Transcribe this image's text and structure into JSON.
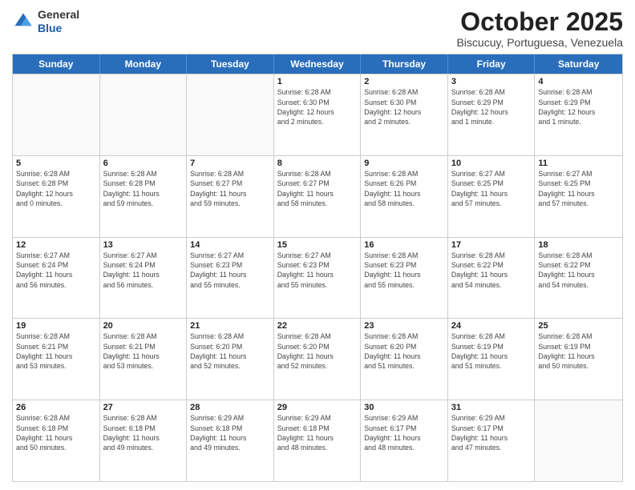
{
  "logo": {
    "line1": "General",
    "line2": "Blue"
  },
  "title": "October 2025",
  "subtitle": "Biscucuy, Portuguesa, Venezuela",
  "days_header": [
    "Sunday",
    "Monday",
    "Tuesday",
    "Wednesday",
    "Thursday",
    "Friday",
    "Saturday"
  ],
  "weeks": [
    [
      {
        "day": "",
        "info": ""
      },
      {
        "day": "",
        "info": ""
      },
      {
        "day": "",
        "info": ""
      },
      {
        "day": "1",
        "info": "Sunrise: 6:28 AM\nSunset: 6:30 PM\nDaylight: 12 hours\nand 2 minutes."
      },
      {
        "day": "2",
        "info": "Sunrise: 6:28 AM\nSunset: 6:30 PM\nDaylight: 12 hours\nand 2 minutes."
      },
      {
        "day": "3",
        "info": "Sunrise: 6:28 AM\nSunset: 6:29 PM\nDaylight: 12 hours\nand 1 minute."
      },
      {
        "day": "4",
        "info": "Sunrise: 6:28 AM\nSunset: 6:29 PM\nDaylight: 12 hours\nand 1 minute."
      }
    ],
    [
      {
        "day": "5",
        "info": "Sunrise: 6:28 AM\nSunset: 6:28 PM\nDaylight: 12 hours\nand 0 minutes."
      },
      {
        "day": "6",
        "info": "Sunrise: 6:28 AM\nSunset: 6:28 PM\nDaylight: 11 hours\nand 59 minutes."
      },
      {
        "day": "7",
        "info": "Sunrise: 6:28 AM\nSunset: 6:27 PM\nDaylight: 11 hours\nand 59 minutes."
      },
      {
        "day": "8",
        "info": "Sunrise: 6:28 AM\nSunset: 6:27 PM\nDaylight: 11 hours\nand 58 minutes."
      },
      {
        "day": "9",
        "info": "Sunrise: 6:28 AM\nSunset: 6:26 PM\nDaylight: 11 hours\nand 58 minutes."
      },
      {
        "day": "10",
        "info": "Sunrise: 6:27 AM\nSunset: 6:25 PM\nDaylight: 11 hours\nand 57 minutes."
      },
      {
        "day": "11",
        "info": "Sunrise: 6:27 AM\nSunset: 6:25 PM\nDaylight: 11 hours\nand 57 minutes."
      }
    ],
    [
      {
        "day": "12",
        "info": "Sunrise: 6:27 AM\nSunset: 6:24 PM\nDaylight: 11 hours\nand 56 minutes."
      },
      {
        "day": "13",
        "info": "Sunrise: 6:27 AM\nSunset: 6:24 PM\nDaylight: 11 hours\nand 56 minutes."
      },
      {
        "day": "14",
        "info": "Sunrise: 6:27 AM\nSunset: 6:23 PM\nDaylight: 11 hours\nand 55 minutes."
      },
      {
        "day": "15",
        "info": "Sunrise: 6:27 AM\nSunset: 6:23 PM\nDaylight: 11 hours\nand 55 minutes."
      },
      {
        "day": "16",
        "info": "Sunrise: 6:28 AM\nSunset: 6:23 PM\nDaylight: 11 hours\nand 55 minutes."
      },
      {
        "day": "17",
        "info": "Sunrise: 6:28 AM\nSunset: 6:22 PM\nDaylight: 11 hours\nand 54 minutes."
      },
      {
        "day": "18",
        "info": "Sunrise: 6:28 AM\nSunset: 6:22 PM\nDaylight: 11 hours\nand 54 minutes."
      }
    ],
    [
      {
        "day": "19",
        "info": "Sunrise: 6:28 AM\nSunset: 6:21 PM\nDaylight: 11 hours\nand 53 minutes."
      },
      {
        "day": "20",
        "info": "Sunrise: 6:28 AM\nSunset: 6:21 PM\nDaylight: 11 hours\nand 53 minutes."
      },
      {
        "day": "21",
        "info": "Sunrise: 6:28 AM\nSunset: 6:20 PM\nDaylight: 11 hours\nand 52 minutes."
      },
      {
        "day": "22",
        "info": "Sunrise: 6:28 AM\nSunset: 6:20 PM\nDaylight: 11 hours\nand 52 minutes."
      },
      {
        "day": "23",
        "info": "Sunrise: 6:28 AM\nSunset: 6:20 PM\nDaylight: 11 hours\nand 51 minutes."
      },
      {
        "day": "24",
        "info": "Sunrise: 6:28 AM\nSunset: 6:19 PM\nDaylight: 11 hours\nand 51 minutes."
      },
      {
        "day": "25",
        "info": "Sunrise: 6:28 AM\nSunset: 6:19 PM\nDaylight: 11 hours\nand 50 minutes."
      }
    ],
    [
      {
        "day": "26",
        "info": "Sunrise: 6:28 AM\nSunset: 6:18 PM\nDaylight: 11 hours\nand 50 minutes."
      },
      {
        "day": "27",
        "info": "Sunrise: 6:28 AM\nSunset: 6:18 PM\nDaylight: 11 hours\nand 49 minutes."
      },
      {
        "day": "28",
        "info": "Sunrise: 6:29 AM\nSunset: 6:18 PM\nDaylight: 11 hours\nand 49 minutes."
      },
      {
        "day": "29",
        "info": "Sunrise: 6:29 AM\nSunset: 6:18 PM\nDaylight: 11 hours\nand 48 minutes."
      },
      {
        "day": "30",
        "info": "Sunrise: 6:29 AM\nSunset: 6:17 PM\nDaylight: 11 hours\nand 48 minutes."
      },
      {
        "day": "31",
        "info": "Sunrise: 6:29 AM\nSunset: 6:17 PM\nDaylight: 11 hours\nand 47 minutes."
      },
      {
        "day": "",
        "info": ""
      }
    ]
  ]
}
